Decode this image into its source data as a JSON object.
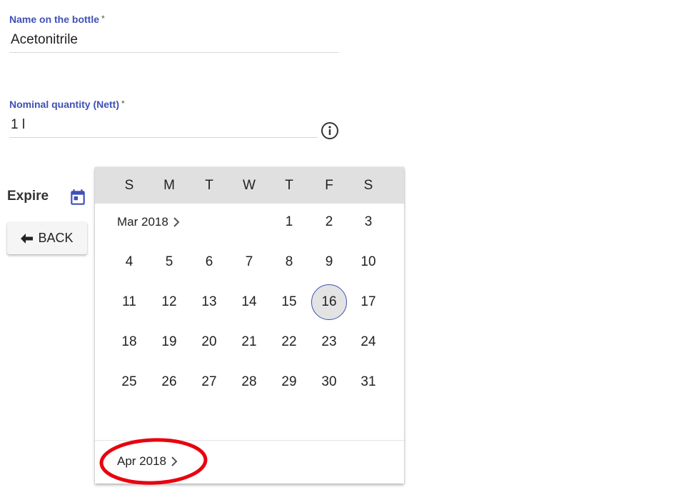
{
  "form": {
    "name_field": {
      "label": "Name on the bottle",
      "required_mark": "*",
      "value": "Acetonitrile"
    },
    "quantity_field": {
      "label": "Nominal quantity (Nett)",
      "required_mark": "*",
      "value": "1 l"
    },
    "expire_label": "Expire",
    "back_button": "BACK",
    "info_icon": "info-circle-icon",
    "calendar_icon": "calendar-icon"
  },
  "calendar": {
    "weekdays": [
      "S",
      "M",
      "T",
      "W",
      "T",
      "F",
      "S"
    ],
    "current_month": "Mar 2018",
    "next_month": "Apr 2018",
    "first_weekday_index": 4,
    "days": [
      "1",
      "2",
      "3",
      "4",
      "5",
      "6",
      "7",
      "8",
      "9",
      "10",
      "11",
      "12",
      "13",
      "14",
      "15",
      "16",
      "17",
      "18",
      "19",
      "20",
      "21",
      "22",
      "23",
      "24",
      "25",
      "26",
      "27",
      "28",
      "29",
      "30",
      "31"
    ],
    "selected_day": "16"
  },
  "colors": {
    "accent": "#3f51b5",
    "header_bg": "#e0e0e0",
    "annotation": "#e8000f"
  }
}
